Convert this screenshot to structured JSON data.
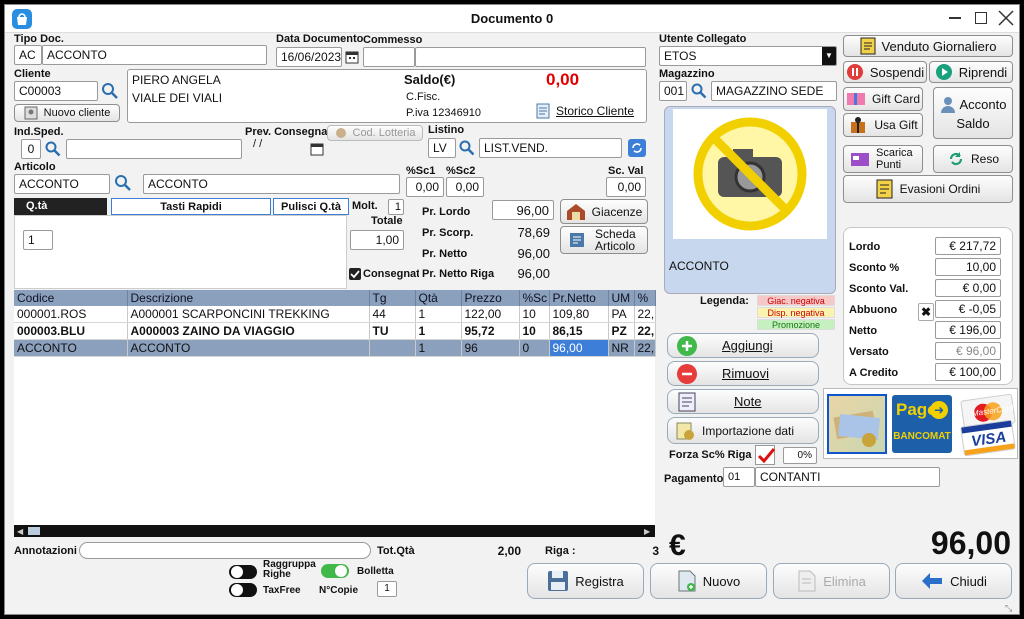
{
  "window": {
    "title": "Documento 0"
  },
  "header": {
    "tipo_doc_label": "Tipo Doc.",
    "tipo_doc_code": "AC",
    "tipo_doc_value": "ACCONTO",
    "data_doc_label": "Data Documento",
    "data_doc_value": "16/06/2023",
    "commesso_label": "Commesso",
    "commesso_value": ""
  },
  "cliente": {
    "label": "Cliente",
    "code": "C00003",
    "nuovo_label": "Nuovo cliente",
    "name": "PIERO ANGELA",
    "address": "VIALE DEI VIALI",
    "saldo_label": "Saldo(€)",
    "saldo_value": "0,00",
    "cfisc_label": "C.Fisc.",
    "piva": "P.iva 12346910",
    "storico_label": "Storico Cliente"
  },
  "sped": {
    "label": "Ind.Sped.",
    "value": "0",
    "prev_label": "Prev. Consegna",
    "prev_value": "/ /",
    "lotteria_label": "Cod. Lotteria",
    "listino_label": "Listino",
    "listino_code": "LV",
    "listino_value": "LIST.VEND."
  },
  "articolo": {
    "label": "Articolo",
    "code": "ACCONTO",
    "desc": "ACCONTO",
    "sc1_label": "%Sc1",
    "sc1": "0,00",
    "sc2_label": "%Sc2",
    "sc2": "0,00",
    "scval_label": "Sc. Val",
    "scval": "0,00",
    "tab_qta": "Q.tà",
    "tab_rapidi": "Tasti Rapidi",
    "tab_pulisci": "Pulisci Q.tà",
    "qta_value": "1",
    "molt_label": "Molt.",
    "molt_value": "1",
    "totale_label": "Totale",
    "totale_value": "1,00",
    "consegnato_label": "Consegnato",
    "pr_lordo_label": "Pr. Lordo",
    "pr_lordo": "96,00",
    "pr_scorp_label": "Pr. Scorp.",
    "pr_scorp": "78,69",
    "pr_netto_label": "Pr. Netto",
    "pr_netto": "96,00",
    "pr_netto_riga_label": "Pr. Netto Riga",
    "pr_netto_riga": "96,00",
    "giacenze_label": "Giacenze",
    "scheda_label": "Scheda Articolo"
  },
  "table": {
    "headers": [
      "Codice",
      "Descrizione",
      "Tg",
      "Qtà",
      "Prezzo",
      "%Sc",
      "Pr.Netto",
      "UM",
      "%"
    ],
    "rows": [
      [
        "000001.ROS",
        "A000001 SCARPONCINI TREKKING",
        "44",
        "1",
        "122,00",
        "10",
        "109,80",
        "PA",
        "22,"
      ],
      [
        "000003.BLU",
        "A000003 ZAINO DA VIAGGIO",
        "TU",
        "1",
        "95,72",
        "10",
        "86,15",
        "PZ",
        "22,"
      ],
      [
        "ACCONTO",
        "ACCONTO",
        "",
        "1",
        "96",
        "0",
        "96,00",
        "NR",
        "22,"
      ]
    ]
  },
  "bottom": {
    "annotazioni_label": "Annotazioni",
    "annotazioni_value": "",
    "tot_qta_label": "Tot.Qtà",
    "tot_qta_value": "2,00",
    "riga_label": "Riga :",
    "riga_value": "3",
    "currency": "€",
    "total": "96,00",
    "raggruppa_label": "Raggruppa Righe",
    "bolletta_label": "Bolletta",
    "taxfree_label": "TaxFree",
    "ncopie_label": "N°Copie",
    "ncopie_value": "1",
    "registra": "Registra",
    "nuovo": "Nuovo",
    "elimina": "Elimina",
    "chiudi": "Chiudi"
  },
  "utente": {
    "label": "Utente Collegato",
    "value": "ETOS"
  },
  "magazzino": {
    "label": "Magazzino",
    "code": "001",
    "value": "MAGAZZINO SEDE"
  },
  "product_caption": "ACCONTO",
  "legend": {
    "label": "Legenda:",
    "items": [
      {
        "text": "Giac. negativa",
        "color": "#f7c8c8"
      },
      {
        "text": "Disp. negativa",
        "color": "#fdf3b0"
      },
      {
        "text": "Promozione",
        "color": "#c6f0c0"
      }
    ]
  },
  "actions": {
    "aggiungi": "Aggiungi",
    "rimuovi": "Rimuovi",
    "note": "Note",
    "importazione": "Importazione dati",
    "forza_label": "Forza Sc% Riga",
    "forza_pct": "0%",
    "pagamento_label": "Pagamento",
    "pagamento_code": "01",
    "pagamento_value": "CONTANTI"
  },
  "right_buttons": {
    "venduto": "Venduto Giornaliero",
    "sospendi": "Sospendi",
    "riprendi": "Riprendi",
    "giftcard": "Gift Card",
    "usagift": "Usa Gift",
    "acconto": "Acconto",
    "saldo": "Saldo",
    "scarica": "Scarica Punti",
    "reso": "Reso",
    "evasioni": "Evasioni Ordini"
  },
  "totals": [
    {
      "label": "Lordo",
      "value": "€ 217,72"
    },
    {
      "label": "Sconto %",
      "value": "10,00"
    },
    {
      "label": "Sconto Val.",
      "value": "€ 0,00"
    },
    {
      "label": "Abbuono",
      "value": "€ -0,05"
    },
    {
      "label": "Netto",
      "value": "€ 196,00"
    },
    {
      "label": "Versato",
      "value": "€ 96,00"
    },
    {
      "label": "A Credito",
      "value": "€ 100,00"
    }
  ],
  "payment_logos": {
    "bancomat_top": "Pago",
    "bancomat_bottom": "BANCOMAT",
    "visa": "VISA",
    "mastercard": "MasterCard"
  },
  "colors": {
    "red": "#e00000",
    "accent": "#3d7ed8",
    "table_header": "#8aa0bd",
    "photo_bg": "#c7d8ee"
  }
}
